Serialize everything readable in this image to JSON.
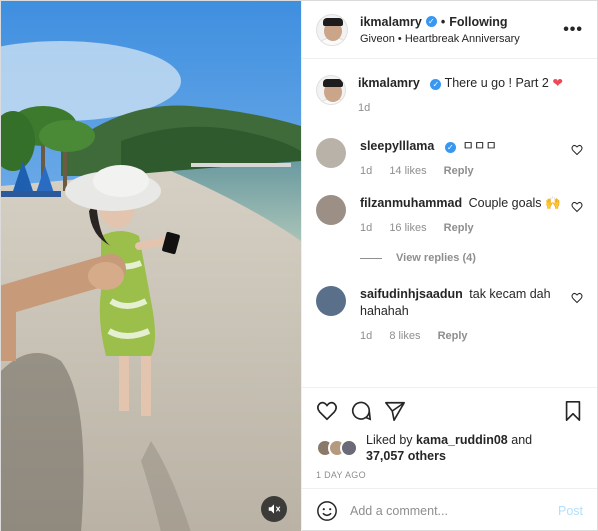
{
  "post": {
    "username": "ikmalamry",
    "following": "Following",
    "separator": "•",
    "subtitle": "Giveon • Heartbreak Anniversary",
    "more_icon": "more-horizontal-icon"
  },
  "caption": {
    "username": "ikmalamry",
    "text": "There u go ! Part 2",
    "emoji": "❤",
    "age": "1d"
  },
  "comments": [
    {
      "username": "sleepylllama",
      "verified": true,
      "text": "ㅁㅁㅁ",
      "age": "1d",
      "likes": "14 likes",
      "reply": "Reply",
      "avatar_color": "#b9b2a8"
    },
    {
      "username": "filzanmuhammad",
      "verified": false,
      "text": "Couple goals 🙌",
      "age": "1d",
      "likes": "16 likes",
      "reply": "Reply",
      "avatar_color": "#9b8f86",
      "view_replies": "View replies (4)"
    },
    {
      "username": "saifudinhjsaadun",
      "verified": false,
      "text": "tak kecam dah hahahah",
      "age": "1d",
      "likes": "8 likes",
      "reply": "Reply",
      "avatar_color": "#5a6f8a"
    }
  ],
  "likes": {
    "prefix": "Liked by",
    "user": "kama_ruddin08",
    "and": "and",
    "others": "37,057 others"
  },
  "time_ago": "1 DAY AGO",
  "add_comment": {
    "placeholder": "Add a comment...",
    "post_label": "Post"
  },
  "colors": {
    "verified": "#3897f0",
    "heart": "#ed4956",
    "post_disabled": "#b2dffc"
  }
}
